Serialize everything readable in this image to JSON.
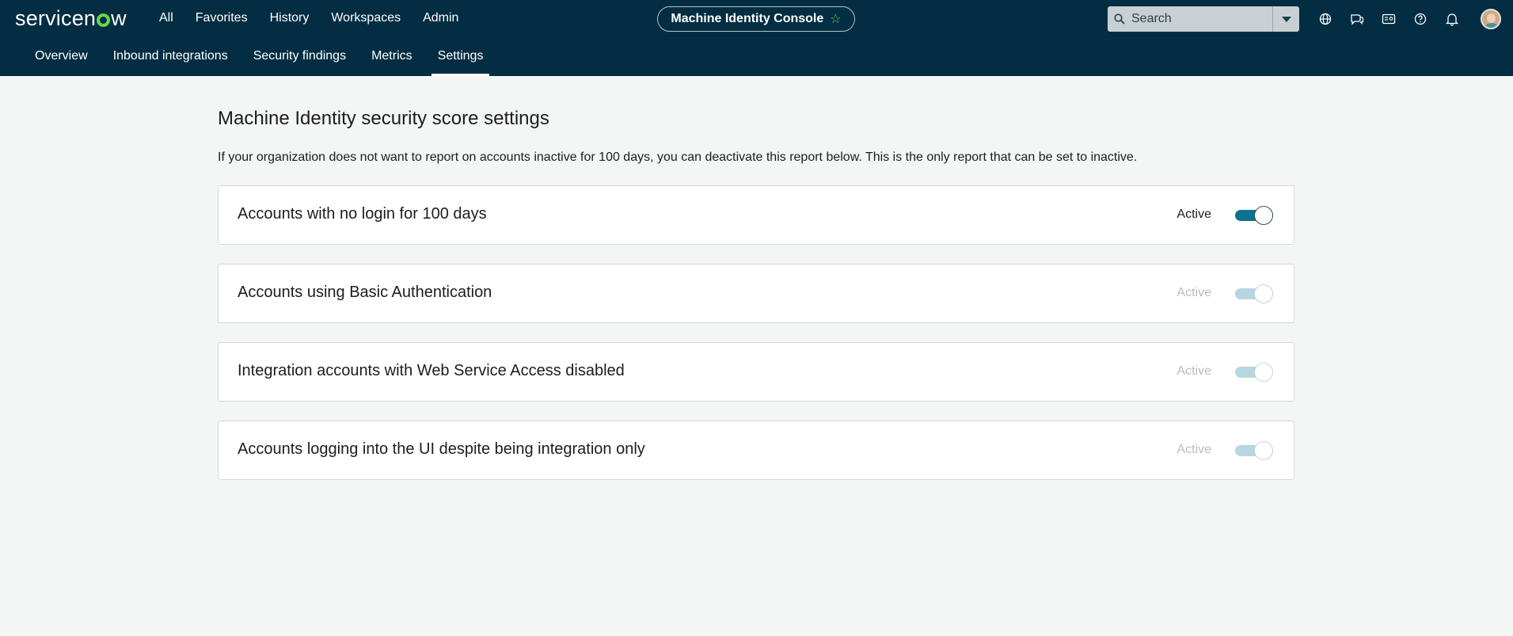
{
  "brand": {
    "name_start": "servicen",
    "name_end": "w"
  },
  "topnav": [
    {
      "label": "All"
    },
    {
      "label": "Favorites"
    },
    {
      "label": "History"
    },
    {
      "label": "Workspaces"
    },
    {
      "label": "Admin"
    }
  ],
  "console": {
    "title": "Machine Identity Console",
    "star_icon": "star-icon"
  },
  "search": {
    "placeholder": "Search"
  },
  "toolbar_icons": [
    "globe-icon",
    "chat-icon",
    "contact-card-icon",
    "help-icon",
    "bell-icon"
  ],
  "subnav": [
    {
      "label": "Overview",
      "active": false
    },
    {
      "label": "Inbound integrations",
      "active": false
    },
    {
      "label": "Security findings",
      "active": false
    },
    {
      "label": "Metrics",
      "active": false
    },
    {
      "label": "Settings",
      "active": true
    }
  ],
  "page": {
    "title": "Machine Identity security score settings",
    "description": "If your organization does not want to report on accounts inactive for 100 days, you can deactivate this report below. This is the only report that can be set to inactive."
  },
  "settings": [
    {
      "label": "Accounts with no login for 100 days",
      "status": "Active",
      "enabled": true,
      "on": true
    },
    {
      "label": "Accounts using Basic Authentication",
      "status": "Active",
      "enabled": false,
      "on": true
    },
    {
      "label": "Integration accounts with Web Service Access disabled",
      "status": "Active",
      "enabled": false,
      "on": true
    },
    {
      "label": "Accounts logging into the UI despite being integration only",
      "status": "Active",
      "enabled": false,
      "on": true
    }
  ],
  "colors": {
    "header_bg": "#032d42",
    "accent_green": "#62d84e",
    "toggle_on": "#0b7390",
    "toggle_disabled": "#b6d6e0",
    "page_bg": "#f4f5f5"
  }
}
